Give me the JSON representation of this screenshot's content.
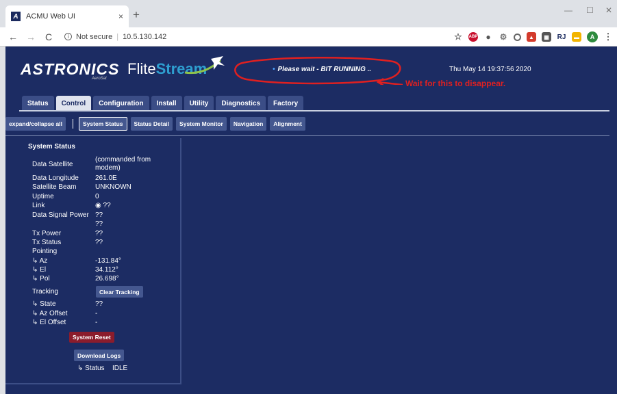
{
  "browser": {
    "tab_title": "ACMU Web UI",
    "tab_close": "×",
    "new_tab": "+",
    "minimize": "—",
    "maximize": "☐",
    "close": "✕",
    "back": "←",
    "forward": "→",
    "reload": "C",
    "security_label": "Not secure",
    "url": "10.5.130.142",
    "extension_icons": [
      "star-icon",
      "adblock-icon",
      "dot-icon",
      "extension-icon",
      "circle-icon",
      "lock-icon",
      "grid-icon",
      "rj-icon",
      "folder-icon",
      "profile-avatar-icon",
      "menu-icon"
    ],
    "avatar_letter": "A",
    "rj_label": "RJ",
    "favicon_letter": "A"
  },
  "header": {
    "brand": "ASTRONICS",
    "brand_sub": "AeroSat",
    "product_flite": "Flite",
    "product_stream": "Stream",
    "status_message": "Please wait - BIT RUNNING ..",
    "annotation": "Wait for this to disappear.",
    "datetime": "Thu May 14 19:37:56 2020",
    "accent_color": "#2e9fd0",
    "annotation_color": "#e02020"
  },
  "main_tabs": [
    {
      "label": "Status",
      "active": false
    },
    {
      "label": "Control",
      "active": true
    },
    {
      "label": "Configuration",
      "active": false
    },
    {
      "label": "Install",
      "active": false
    },
    {
      "label": "Utility",
      "active": false
    },
    {
      "label": "Diagnostics",
      "active": false
    },
    {
      "label": "Factory",
      "active": false
    }
  ],
  "sub_nav": {
    "expand_collapse": "expand/collapse all",
    "items": [
      {
        "label": "System Status",
        "active": true
      },
      {
        "label": "Status Detail",
        "active": false
      },
      {
        "label": "System Monitor",
        "active": false
      },
      {
        "label": "Navigation",
        "active": false
      },
      {
        "label": "Alignment",
        "active": false
      }
    ]
  },
  "system_status": {
    "title": "System Status",
    "data_satellite_label": "Data Satellite",
    "data_satellite_value": "(commanded from modem)",
    "data_longitude_label": "Data Longitude",
    "data_longitude_value": "261.0E",
    "satellite_beam_label": "Satellite Beam",
    "satellite_beam_value": "UNKNOWN",
    "uptime_label": "Uptime",
    "uptime_value": "0",
    "link_label": "Link",
    "link_value": "◉ ??",
    "data_signal_power_label": "Data Signal Power",
    "data_signal_power_value": "??",
    "data_signal_power_value2": "??",
    "tx_power_label": "Tx Power",
    "tx_power_value": "??",
    "tx_status_label": "Tx Status",
    "tx_status_value": "??",
    "pointing_label": "Pointing",
    "az_label": "↳ Az",
    "az_value": "-131.84°",
    "el_label": "↳ El",
    "el_value": "34.112°",
    "pol_label": "↳ Pol",
    "pol_value": "26.698°",
    "tracking_label": "Tracking",
    "clear_tracking": "Clear Tracking",
    "state_label": "↳ State",
    "state_value": "??",
    "az_offset_label": "↳ Az Offset",
    "az_offset_value": "-",
    "el_offset_label": "↳ El Offset",
    "el_offset_value": "-",
    "system_reset": "System Reset",
    "download_logs": "Download Logs",
    "status_label": "↳ Status",
    "status_value": "IDLE"
  }
}
